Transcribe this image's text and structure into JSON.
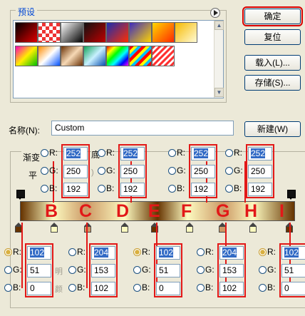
{
  "preset": {
    "title": "预设",
    "swatches": [
      "linear-gradient(135deg,#000,#e00000)",
      "repeating-conic-gradient(#e33 0 25%,#fff 0 50%) 0 0/10px 10px",
      "linear-gradient(135deg,#fff,#000)",
      "linear-gradient(135deg,#111,#c00000)",
      "linear-gradient(135deg,#1a2fb0,#ff2d00)",
      "linear-gradient(135deg,#3d2bbf,#ffd400)",
      "linear-gradient(135deg,#ffd700,#ff2a00)",
      "linear-gradient(135deg,#f6b900,#fffbd6)",
      "linear-gradient(135deg,#ff00b4,#ffee00,#00c000)",
      "linear-gradient(135deg,#ff8c00,#fff,#0050ff)",
      "linear-gradient(135deg,#6a3206,#f6d9b5,#6a3206)",
      "linear-gradient(135deg,#12a35a,#c8f0ff,#0a4fb0)",
      "linear-gradient(135deg,#ff0000,#ffff00,#00ff00,#00ffff,#0000ff,#ff00ff)",
      "repeating-linear-gradient(135deg,#ff0000 0 4px,#ffff00 4px 8px,#00c0ff 8px 12px)",
      "repeating-linear-gradient(135deg,#ff3333 0 3px,#fff 3px 6px)"
    ]
  },
  "buttons": {
    "ok": "确定",
    "reset": "复位",
    "load": "载入(L)...",
    "save": "存储(S)...",
    "new": "新建(W)"
  },
  "name": {
    "label": "名称(N):",
    "value": "Custom"
  },
  "gradient_labels": {
    "g1": "渐变",
    "g2": "平",
    "g3": "底"
  },
  "letters": [
    "B",
    "C",
    "D",
    "E",
    "F",
    "G",
    "H",
    "I"
  ],
  "top_colors": [
    {
      "r": "252",
      "g": "250",
      "b": "192"
    },
    {
      "r": "252",
      "g": "250",
      "b": "192"
    },
    {
      "r": "252",
      "g": "250",
      "b": "192"
    },
    {
      "r": "252",
      "g": "250",
      "b": "192"
    }
  ],
  "bottom_colors": [
    {
      "r": "102",
      "g": "51",
      "b": "0"
    },
    {
      "r": "204",
      "g": "153",
      "b": "102"
    },
    {
      "r": "102",
      "g": "51",
      "b": "0"
    },
    {
      "r": "204",
      "g": "153",
      "b": "102"
    },
    {
      "r": "102",
      "g": "51",
      "b": "0"
    }
  ],
  "channels": {
    "r": "R:",
    "g": "G:",
    "b": "B:"
  },
  "colors": {
    "dark": "#663300",
    "tan": "#cc9966",
    "light": "#fcfac0",
    "annotation": "#e21818"
  }
}
